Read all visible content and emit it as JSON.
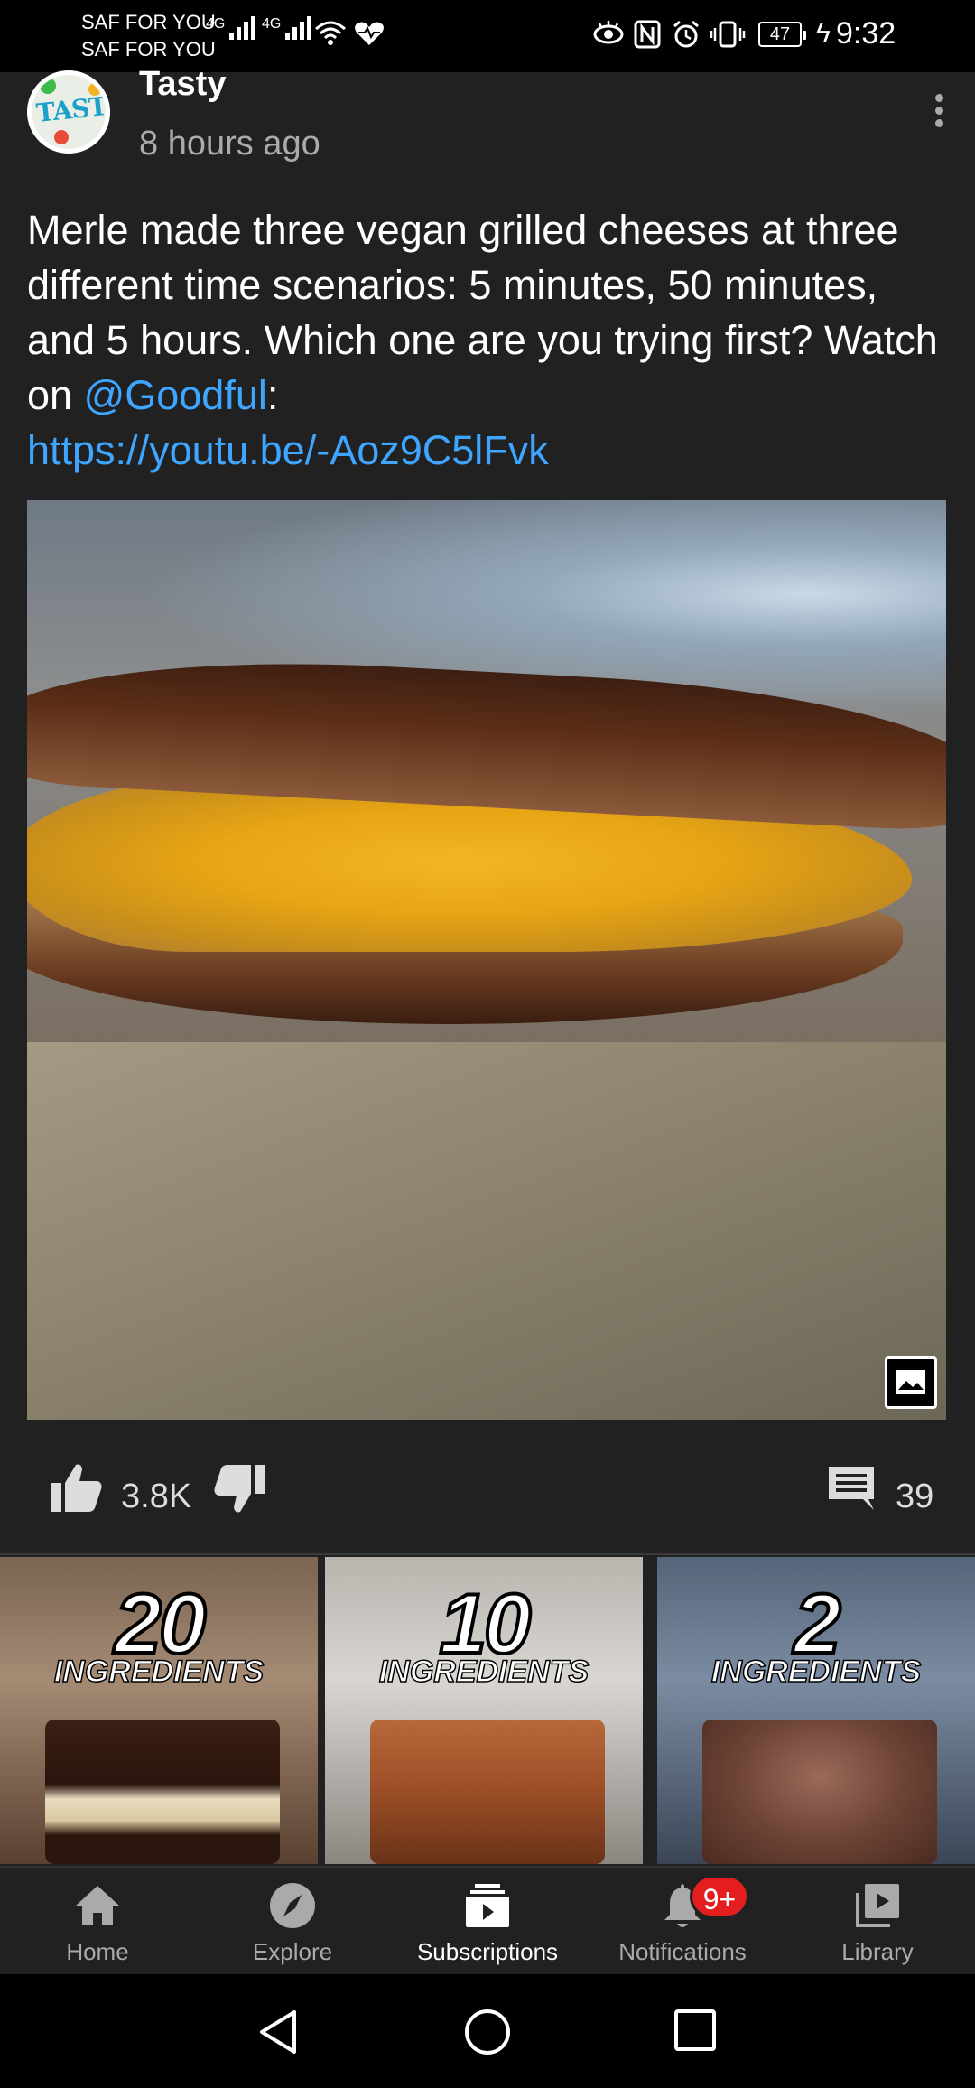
{
  "status_bar": {
    "carrier_1": "SAF FOR YOU",
    "carrier_2": "SAF FOR YOU",
    "network_1": "4G",
    "network_2": "4G",
    "battery": "47",
    "time": "9:32"
  },
  "post": {
    "channel_name": "Tasty",
    "avatar_text": "TASTY",
    "posted_time": "8 hours ago",
    "text_main": "Merle made three vegan grilled cheeses at three different time scenarios: 5 minutes, 50 minutes, and 5 hours. Which one are you trying first? Watch on ",
    "mention": "@Goodful",
    "mention_suffix": ":",
    "url": "https://youtu.be/-Aoz9C5lFvk",
    "likes": "3.8K",
    "comments": "39"
  },
  "thumbnails": [
    {
      "number": "20",
      "label": "INGREDIENTS"
    },
    {
      "number": "10",
      "label": "INGREDIENTS"
    },
    {
      "number": "2",
      "label": "INGREDIENTS"
    }
  ],
  "bottom_nav": {
    "items": [
      {
        "label": "Home"
      },
      {
        "label": "Explore"
      },
      {
        "label": "Subscriptions"
      },
      {
        "label": "Notifications"
      },
      {
        "label": "Library"
      }
    ],
    "notifications_badge": "9+",
    "active": "Subscriptions"
  },
  "colors": {
    "background": "#212121",
    "link": "#3ea6ff",
    "badge": "#e41e1e"
  }
}
